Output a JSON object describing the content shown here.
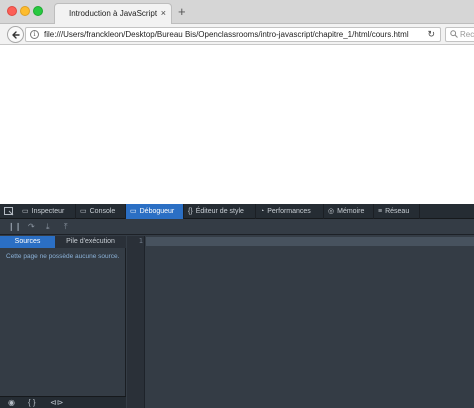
{
  "browser": {
    "tab_title": "Introduction à JavaScript",
    "tab_close": "×",
    "new_tab": "+",
    "url": "file:///Users/franckleon/Desktop/Bureau Bis/Openclassrooms/intro-javascript/chapitre_1/html/cours.html",
    "search_placeholder": "Rech",
    "reload_glyph": "↻",
    "info_glyph": "i",
    "icons": [
      "back-arrow-icon",
      "info-icon",
      "reload-icon",
      "search-icon"
    ]
  },
  "devtools": {
    "tabs": [
      {
        "label": "Inspecteur",
        "icon": "▭"
      },
      {
        "label": "Console",
        "icon": "▭"
      },
      {
        "label": "Débogueur",
        "icon": "▭"
      },
      {
        "label": "Éditeur de style",
        "icon": "{}"
      },
      {
        "label": "Performances",
        "icon": "◔"
      },
      {
        "label": "Mémoire",
        "icon": "◎"
      },
      {
        "label": "Réseau",
        "icon": "≡"
      }
    ],
    "active_tab": "Débogueur",
    "controls": [
      "❙❙",
      "↷",
      "⤓",
      "⤒"
    ],
    "subtabs": [
      "Sources",
      "Pile d'exécution"
    ],
    "active_subtab": "Sources",
    "no_source_message": "Cette page ne possède aucune source.",
    "line_number": "1",
    "footer_icons": [
      "◉",
      "{ }",
      "⊲⊳"
    ],
    "colors": {
      "toolbar_bg": "#252c33",
      "panel_bg": "#343c45",
      "accent": "#2b6fc4",
      "highlight_text": "#8ab0d6"
    }
  }
}
